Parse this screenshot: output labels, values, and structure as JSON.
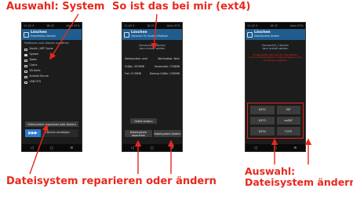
{
  "annotations": {
    "select_system": "Auswahl: System",
    "mine_ext4": "So ist das bei mir (ext4)",
    "repair_or_change": "Dateisystem reparieren oder ändern",
    "select_fs_line1": "Auswahl:",
    "select_fs_line2": "Dateisystem ändern"
  },
  "colors": {
    "annotation": "#e8281c",
    "titlebar": "#1f5d8f",
    "screen_bg": "#1c1c1c"
  },
  "phone1": {
    "status_left": "11:42 5",
    "status_mid": "18:22",
    "status_right": "Akku 67%",
    "title": "Löschen",
    "subtitle": "Erweitertes Löschen",
    "section_label": "Partitionen zum Löschen auswählen",
    "items": [
      {
        "label": "Dalvik / ART Cache",
        "checked": false
      },
      {
        "label": "System",
        "checked": true
      },
      {
        "label": "Daten",
        "checked": false
      },
      {
        "label": "Cache",
        "checked": false
      },
      {
        "label": "SD-Karte",
        "checked": false
      },
      {
        "label": "Android Secure",
        "checked": false
      },
      {
        "label": "USB-OTG",
        "checked": false
      }
    ],
    "repair_button": "Dateisystem reparieren oder ändern",
    "swipe_label": "Löschen bestätigen"
  },
  "phone2": {
    "status_left": "11:42 5",
    "status_mid": "18:22",
    "status_right": "Akku 67%",
    "title": "Löschen",
    "subtitle": "Optionen für System-Partition",
    "mount": "Gemountet / Löschen",
    "mount_sub": "kann erstellt werden",
    "info": [
      {
        "k": "Dateisystem: ext4",
        "v": "Wechselbar: Nein"
      },
      {
        "k": "Größe: 3976MB",
        "v": "Verwendet: 1758MB"
      },
      {
        "k": "Frei: 2139MB",
        "v": "Backup-Größe: 1760MB"
      }
    ],
    "resize_button": "Größe ändern",
    "repair_button": "Dateisystem reparieren",
    "change_button": "Dateisystem ändern"
  },
  "phone3": {
    "status_left": "11:42 5",
    "status_mid": "18:22",
    "status_right": "Akku 67%",
    "title": "Löschen",
    "subtitle": "Dateisystem ändern",
    "mount": "Gemountet / Löschen",
    "mount_sub": "kann erstellt werden",
    "warning": "Einige ROMs oder Kernel unterstützen manche Dateisysteme möglicherweise nicht. Vorsichtig vorgehen!",
    "fs_buttons": [
      "EXT2",
      "FAT",
      "EXT3",
      "exFAT",
      "EXT4",
      "F2FS"
    ]
  }
}
